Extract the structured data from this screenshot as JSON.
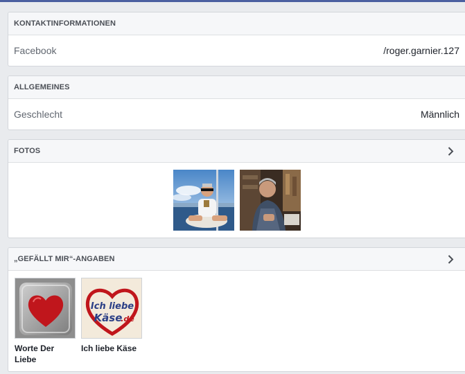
{
  "contact": {
    "header": "KONTAKTINFORMATIONEN",
    "row": {
      "label": "Facebook",
      "value": "/roger.garnier.127"
    }
  },
  "general": {
    "header": "ALLGEMEINES",
    "row": {
      "label": "Geschlecht",
      "value": "Männlich"
    }
  },
  "photos": {
    "header": "FOTOS",
    "icon": "chevron-right-icon"
  },
  "likes": {
    "header": "„GEFÄLLT MIR“-ANGABEN",
    "icon": "chevron-right-icon",
    "items": [
      {
        "name": "Worte Der Liebe"
      },
      {
        "name": "Ich liebe Käse",
        "logo_text": "Ich liebe Käse.de"
      }
    ]
  },
  "colors": {
    "accent": "#4b5fa0",
    "heart": "#c0161c"
  }
}
